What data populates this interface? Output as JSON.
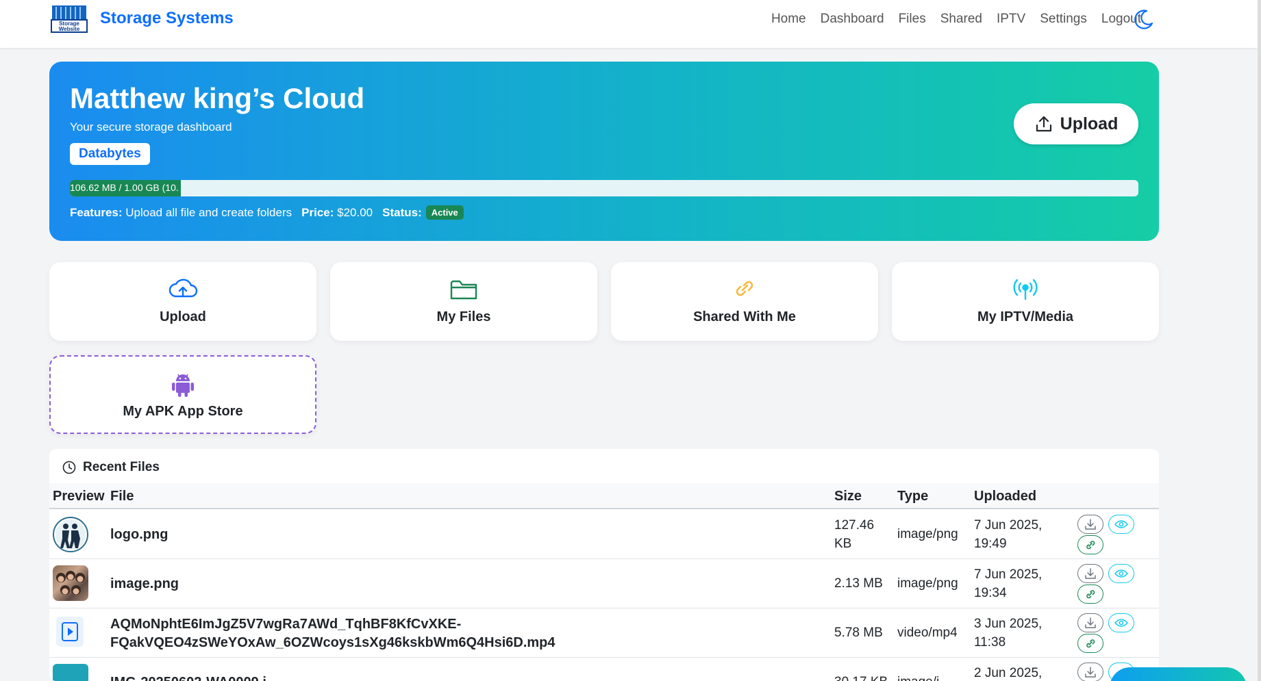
{
  "brand": {
    "name": "Storage Systems",
    "logo_text": "Storage Website"
  },
  "nav": {
    "links": [
      "Home",
      "Dashboard",
      "Files",
      "Shared",
      "IPTV",
      "Settings",
      "Logout"
    ]
  },
  "hero": {
    "title": "Matthew king’s Cloud",
    "subtitle": "Your secure storage dashboard",
    "plan": "Databytes",
    "upload_label": "Upload",
    "usage_text": "106.62 MB / 1.00 GB (10.",
    "usage_fraction": 0.1041,
    "features_label": "Features:",
    "features_value": "Upload all file and create folders",
    "price_label": "Price:",
    "price_value": "$20.00",
    "status_label": "Status:",
    "status_value": "Active"
  },
  "cards": {
    "upload": "Upload",
    "my_files": "My Files",
    "shared": "Shared With Me",
    "iptv": "My IPTV/Media",
    "apk": "My APK App Store"
  },
  "recent": {
    "title": "Recent Files",
    "columns": {
      "preview": "Preview",
      "file": "File",
      "size": "Size",
      "type": "Type",
      "uploaded": "Uploaded"
    },
    "rows": [
      {
        "file": "logo.png",
        "size_1": "127.46",
        "size_2": "KB",
        "type": "image/png",
        "date": "7 Jun 2025,",
        "time": "19:49"
      },
      {
        "file": "image.png",
        "size_1": "2.13 MB",
        "size_2": "",
        "type": "image/png",
        "date": "7 Jun 2025,",
        "time": "19:34"
      },
      {
        "file_1": "AQMoNphtE6ImJgZ5V7wgRa7AWd_TqhBF8KfCvXKE-",
        "file_2": "FQakVQEO4zSWeYOxAw_6OZWcoys1sXg46kskbWm6Q4Hsi6D.mp4",
        "size_1": "5.78 MB",
        "size_2": "",
        "type": "video/mp4",
        "date": "3 Jun 2025,",
        "time": "11:38"
      },
      {
        "file": "IMG-20250602-WA0009.j",
        "size_1": "30.17 KB",
        "type": "image/j",
        "date": "2 Jun 2025,"
      }
    ]
  },
  "colors": {
    "primary": "#0d6efd",
    "success": "#198754",
    "apk": "#8b5cd6",
    "iptv": "#0dcaf0",
    "link": "#f6b93b"
  }
}
